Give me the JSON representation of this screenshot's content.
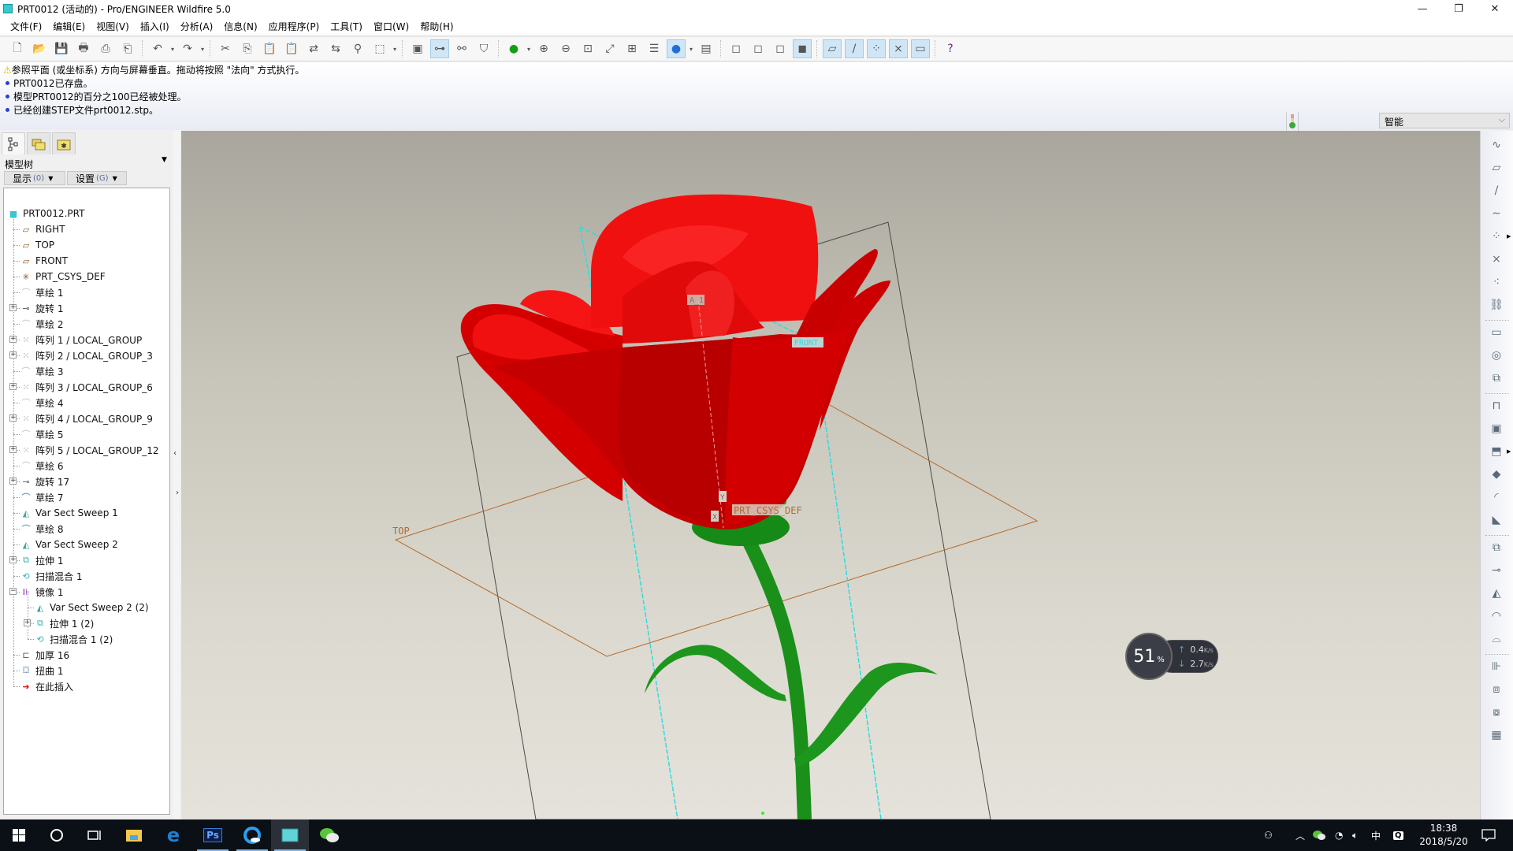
{
  "window": {
    "title": "PRT0012 (活动的) - Pro/ENGINEER Wildfire 5.0",
    "controls": {
      "minimize": "—",
      "restore": "❐",
      "close": "✕"
    }
  },
  "menubar": {
    "items": [
      "文件(F)",
      "编辑(E)",
      "视图(V)",
      "插入(I)",
      "分析(A)",
      "信息(N)",
      "应用程序(P)",
      "工具(T)",
      "窗口(W)",
      "帮助(H)"
    ]
  },
  "toolbar": {
    "buttons": [
      {
        "name": "new-icon",
        "glyph": "🗋"
      },
      {
        "name": "open-icon",
        "glyph": "📂"
      },
      {
        "name": "save-icon",
        "glyph": "💾"
      },
      {
        "name": "print-icon",
        "glyph": "🖶"
      },
      {
        "name": "send-mail-icon",
        "glyph": "⎙"
      },
      {
        "name": "send-mail-attach-icon",
        "glyph": "⎗"
      },
      {
        "name": "undo-icon",
        "glyph": "↶"
      },
      {
        "name": "redo-icon",
        "glyph": "↷"
      },
      {
        "name": "cut-icon",
        "glyph": "✂"
      },
      {
        "name": "copy-icon",
        "glyph": "⎘"
      },
      {
        "name": "paste-icon",
        "glyph": "📋"
      },
      {
        "name": "paste-special-icon",
        "glyph": "📋"
      },
      {
        "name": "regenerate-icon",
        "glyph": "⇄"
      },
      {
        "name": "regen-manager-icon",
        "glyph": "⇆"
      },
      {
        "name": "find-icon",
        "glyph": "⚲"
      },
      {
        "name": "select-box-icon",
        "glyph": "⬚"
      },
      {
        "name": "repaint-icon",
        "glyph": "▣"
      },
      {
        "name": "spin-center-icon",
        "glyph": "⊶"
      },
      {
        "name": "orient-mode-icon",
        "glyph": "⚯"
      },
      {
        "name": "saved-views-icon",
        "glyph": "⛉"
      },
      {
        "name": "appearance-icon",
        "glyph": "●"
      },
      {
        "name": "zoom-in-icon",
        "glyph": "⊕"
      },
      {
        "name": "zoom-out-icon",
        "glyph": "⊖"
      },
      {
        "name": "refit-icon",
        "glyph": "⊡"
      },
      {
        "name": "reorient-icon",
        "glyph": "⤢"
      },
      {
        "name": "view-manager-icon",
        "glyph": "⊞"
      },
      {
        "name": "layers-icon",
        "glyph": "☰"
      },
      {
        "name": "display-style-icon",
        "glyph": "●"
      },
      {
        "name": "model-display-icon",
        "glyph": "▤"
      },
      {
        "name": "wireframe-icon",
        "glyph": "◻"
      },
      {
        "name": "hidden-line-icon",
        "glyph": "◻"
      },
      {
        "name": "no-hidden-icon",
        "glyph": "◻"
      },
      {
        "name": "shading-icon",
        "glyph": "◼"
      },
      {
        "name": "plane-display-icon",
        "glyph": "▱"
      },
      {
        "name": "axis-display-icon",
        "glyph": "/"
      },
      {
        "name": "point-display-icon",
        "glyph": "⁘"
      },
      {
        "name": "csys-display-icon",
        "glyph": "⨯"
      },
      {
        "name": "annotation-display-icon",
        "glyph": "▭"
      },
      {
        "name": "context-help-icon",
        "glyph": "?"
      }
    ]
  },
  "messages": [
    {
      "type": "warning",
      "text": "参照平面 (或坐标系) 方向与屏幕垂直。拖动将按照 \"法向\" 方式执行。"
    },
    {
      "type": "info",
      "text": "PRT0012已存盘。"
    },
    {
      "type": "info",
      "text": "模型PRT0012的百分之100已经被处理。"
    },
    {
      "type": "info",
      "text": "已经创建STEP文件prt0012.stp。"
    }
  ],
  "filter": {
    "selected": "智能"
  },
  "model_tree": {
    "panel_title": "模型树",
    "show_button": {
      "label": "显示",
      "accel": "(0)"
    },
    "settings_button": {
      "label": "设置",
      "accel": "(G)"
    },
    "nodes": [
      {
        "label": "PRT0012.PRT",
        "depth": 0,
        "icon": "part-icon",
        "glyph": "■",
        "color": "#38c6cf",
        "expand": null
      },
      {
        "label": "RIGHT",
        "depth": 1,
        "icon": "datum-plane-icon",
        "glyph": "▱",
        "color": "#8a5a2b",
        "expand": null
      },
      {
        "label": "TOP",
        "depth": 1,
        "icon": "datum-plane-icon",
        "glyph": "▱",
        "color": "#8a5a2b",
        "expand": null
      },
      {
        "label": "FRONT",
        "depth": 1,
        "icon": "datum-plane-icon",
        "glyph": "▱",
        "color": "#8a5a2b",
        "expand": null
      },
      {
        "label": "PRT_CSYS_DEF",
        "depth": 1,
        "icon": "csys-icon",
        "glyph": "✳",
        "color": "#8a5a2b",
        "expand": null
      },
      {
        "label": "草绘 1",
        "depth": 1,
        "icon": "sketch-hidden-icon",
        "glyph": "⌒",
        "color": "#bbbbbb",
        "expand": null
      },
      {
        "label": "旋转 1",
        "depth": 1,
        "icon": "revolve-icon",
        "glyph": "⊸",
        "color": "#555555",
        "expand": "+"
      },
      {
        "label": "草绘 2",
        "depth": 1,
        "icon": "sketch-hidden-icon",
        "glyph": "⌒",
        "color": "#bbbbbb",
        "expand": null
      },
      {
        "label": "阵列 1 / LOCAL_GROUP",
        "depth": 1,
        "icon": "pattern-icon",
        "glyph": "⁙",
        "color": "#777777",
        "expand": "+"
      },
      {
        "label": "阵列 2 / LOCAL_GROUP_3",
        "depth": 1,
        "icon": "pattern-icon",
        "glyph": "⁙",
        "color": "#777777",
        "expand": "+"
      },
      {
        "label": "草绘 3",
        "depth": 1,
        "icon": "sketch-hidden-icon",
        "glyph": "⌒",
        "color": "#bbbbbb",
        "expand": null
      },
      {
        "label": "阵列 3 / LOCAL_GROUP_6",
        "depth": 1,
        "icon": "pattern-icon",
        "glyph": "⁙",
        "color": "#777777",
        "expand": "+"
      },
      {
        "label": "草绘 4",
        "depth": 1,
        "icon": "sketch-hidden-icon",
        "glyph": "⌒",
        "color": "#bbbbbb",
        "expand": null
      },
      {
        "label": "阵列 4 / LOCAL_GROUP_9",
        "depth": 1,
        "icon": "pattern-icon",
        "glyph": "⁙",
        "color": "#777777",
        "expand": "+"
      },
      {
        "label": "草绘 5",
        "depth": 1,
        "icon": "sketch-hidden-icon",
        "glyph": "⌒",
        "color": "#bbbbbb",
        "expand": null
      },
      {
        "label": "阵列 5 / LOCAL_GROUP_12",
        "depth": 1,
        "icon": "pattern-icon",
        "glyph": "⁙",
        "color": "#777777",
        "expand": "+"
      },
      {
        "label": "草绘 6",
        "depth": 1,
        "icon": "sketch-hidden-icon",
        "glyph": "⌒",
        "color": "#bbbbbb",
        "expand": null
      },
      {
        "label": "旋转 17",
        "depth": 1,
        "icon": "revolve-icon",
        "glyph": "⊸",
        "color": "#555555",
        "expand": "+"
      },
      {
        "label": "草绘 7",
        "depth": 1,
        "icon": "sketch-icon",
        "glyph": "⌒",
        "color": "#2a7aa8",
        "expand": null
      },
      {
        "label": "Var Sect Sweep 1",
        "depth": 1,
        "icon": "var-sect-sweep-icon",
        "glyph": "◭",
        "color": "#3fa7a0",
        "expand": null
      },
      {
        "label": "草绘 8",
        "depth": 1,
        "icon": "sketch-icon",
        "glyph": "⌒",
        "color": "#2a7aa8",
        "expand": null
      },
      {
        "label": "Var Sect Sweep 2",
        "depth": 1,
        "icon": "var-sect-sweep-icon",
        "glyph": "◭",
        "color": "#3fa7a0",
        "expand": null
      },
      {
        "label": "拉伸 1",
        "depth": 1,
        "icon": "extrude-icon",
        "glyph": "⧉",
        "color": "#2fb3b0",
        "expand": "+"
      },
      {
        "label": "扫描混合 1",
        "depth": 1,
        "icon": "swept-blend-icon",
        "glyph": "⟲",
        "color": "#2fb3b0",
        "expand": null
      },
      {
        "label": "镜像 1",
        "depth": 1,
        "icon": "mirror-icon",
        "glyph": "⊪",
        "color": "#8a3fb0",
        "expand": "−"
      },
      {
        "label": "Var Sect Sweep 2 (2)",
        "depth": 2,
        "icon": "var-sect-sweep-icon",
        "glyph": "◭",
        "color": "#3fa7a0",
        "expand": null
      },
      {
        "label": "拉伸 1 (2)",
        "depth": 2,
        "icon": "extrude-icon",
        "glyph": "⧉",
        "color": "#2fb3b0",
        "expand": "+"
      },
      {
        "label": "扫描混合 1 (2)",
        "depth": 2,
        "icon": "swept-blend-icon",
        "glyph": "⟲",
        "color": "#2fb3b0",
        "expand": null
      },
      {
        "label": "加厚 16",
        "depth": 1,
        "icon": "thicken-icon",
        "glyph": "⊏",
        "color": "#555555",
        "expand": null
      },
      {
        "label": "扭曲 1",
        "depth": 1,
        "icon": "warp-icon",
        "glyph": "⛋",
        "color": "#5f7f9f",
        "expand": null
      },
      {
        "label": "在此插入",
        "depth": 1,
        "icon": "insert-here-icon",
        "glyph": "➜",
        "color": "#d21a1a",
        "expand": null
      }
    ]
  },
  "viewport": {
    "datum_labels": {
      "top_plane": "TOP",
      "csys": "PRT_CSYS_DEF",
      "axis": "A_1",
      "front_plane": "FRONT",
      "x_axis": "X",
      "y_axis": "Y"
    },
    "colors": {
      "petal": "#e80000",
      "petal_shadow": "#b80000",
      "stem": "#1a8f1a",
      "datum_cyan": "#2fdbe0",
      "datum_brown": "#b46a2a"
    }
  },
  "right_toolbar": {
    "icons": [
      "sketched-datum-curve-icon",
      "datum-plane-tool-icon",
      "datum-axis-tool-icon",
      "datum-curve-tool-icon",
      "datum-point-tool-icon",
      "csys-tool-icon",
      "analysis-feature-icon",
      "datum-ref-icon",
      "sketch-tool-icon",
      "sketch-insert-icon",
      "sketch-layout-icon",
      "hole-tool-icon",
      "shell-tool-icon",
      "rib-tool-icon",
      "draft-tool-icon",
      "round-tool-icon",
      "chamfer-tool-icon",
      "extrude-tool-icon",
      "revolve-tool-icon",
      "var-sect-sweep-tool-icon",
      "boundary-blend-tool-icon",
      "style-tool-icon",
      "mirror-tool-icon",
      "merge-tool-icon",
      "trim-tool-icon",
      "pattern-tool-icon"
    ]
  },
  "net_widget": {
    "cpu_percent": "51",
    "percent_sign": "%",
    "upload": "0.4",
    "download": "2.7",
    "unit": "K/s"
  },
  "taskbar": {
    "apps": [
      "start-icon",
      "search-icon",
      "task-view-icon",
      "file-explorer-icon",
      "edge-icon",
      "photoshop-icon",
      "qq-browser-icon",
      "proe-icon",
      "wechat-icon"
    ],
    "ps_label": "Ps",
    "ime": "中",
    "time": "18:38",
    "date": "2018/5/20"
  }
}
